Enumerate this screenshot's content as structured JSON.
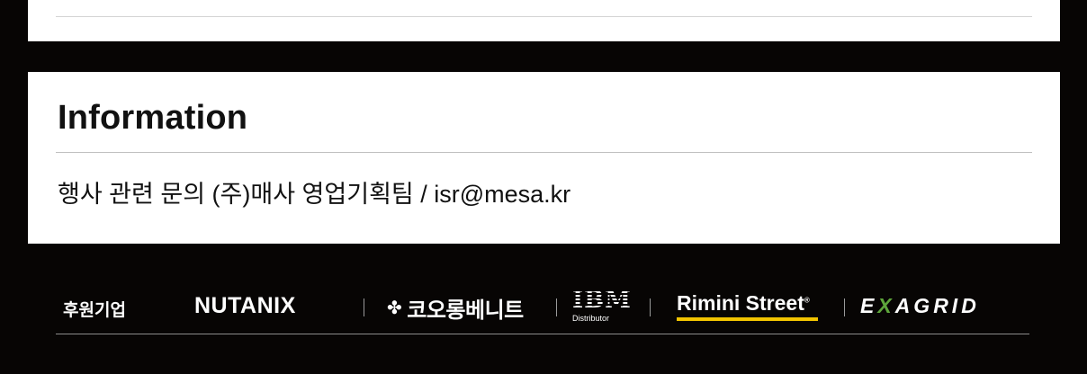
{
  "info": {
    "title": "Information",
    "text": "행사 관련 문의 (주)매사 영업기획팀 / isr@mesa.kr"
  },
  "sponsors": {
    "label": "후원기업",
    "logos": {
      "nutanix": "NUTANIX",
      "kolon": "코오롱베니트",
      "ibm": "IBM",
      "ibm_sub": "Distributor",
      "rimini": "Rimini Street",
      "exagrid_a": "E",
      "exagrid_x": "X",
      "exagrid_b": "AGRID"
    }
  },
  "colors": {
    "background": "#070504",
    "card": "#ffffff",
    "rimini_underline": "#f2c400",
    "exagrid_accent": "#5ea63b"
  }
}
